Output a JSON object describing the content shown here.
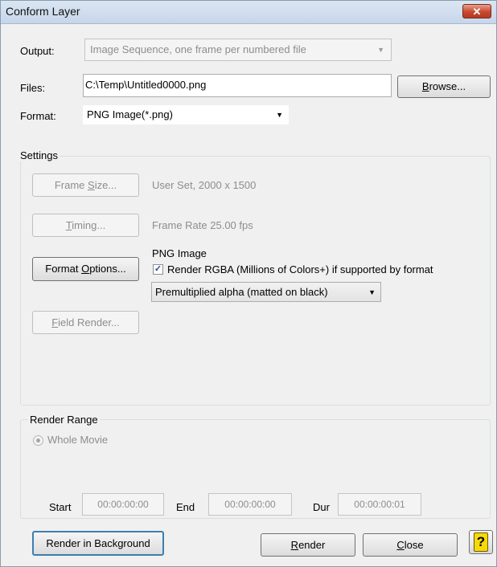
{
  "window": {
    "title": "Conform Layer",
    "close_glyph": "✕"
  },
  "output": {
    "label": "Output:",
    "value": "Image Sequence, one frame per numbered file"
  },
  "files": {
    "label": "Files:",
    "value": "C:\\Temp\\Untitled0000.png",
    "browse_pre": "",
    "browse_u": "B",
    "browse_post": "rowse..."
  },
  "format": {
    "label": "Format:",
    "value": "PNG Image(*.png)"
  },
  "settings": {
    "title": "Settings",
    "frame_size": {
      "pre": "Frame ",
      "u": "S",
      "post": "ize...",
      "info": "User Set, 2000 x 1500"
    },
    "timing": {
      "pre": "",
      "u": "T",
      "post": "iming...",
      "info": "Frame Rate 25.00 fps"
    },
    "format_options": {
      "pre": "Format ",
      "u": "O",
      "post": "ptions...",
      "info_title": "PNG Image"
    },
    "rgba_checkbox": {
      "label": "Render RGBA (Millions of Colors+) if supported by format",
      "checked": true,
      "mark": "✓"
    },
    "alpha_select": {
      "value": "Premultiplied alpha (matted on black)"
    },
    "field_render": {
      "pre": "",
      "u": "F",
      "post": "ield Render..."
    }
  },
  "render_range": {
    "title": "Render Range",
    "whole_movie": "Whole Movie",
    "start_label": "Start",
    "start_value": "00:00:00:00",
    "end_label": "End",
    "end_value": "00:00:00:00",
    "dur_label": "Dur",
    "dur_value": "00:00:00:01"
  },
  "buttons": {
    "render_background": "Render in Background",
    "render_pre": "",
    "render_u": "R",
    "render_post": "ender",
    "close_pre": "",
    "close_u": "C",
    "close_post": "lose",
    "help": "?"
  },
  "colors": {
    "title_bg": "#c6d6ea",
    "close_red": "#c8472f",
    "help_yellow": "#f5d90a"
  }
}
